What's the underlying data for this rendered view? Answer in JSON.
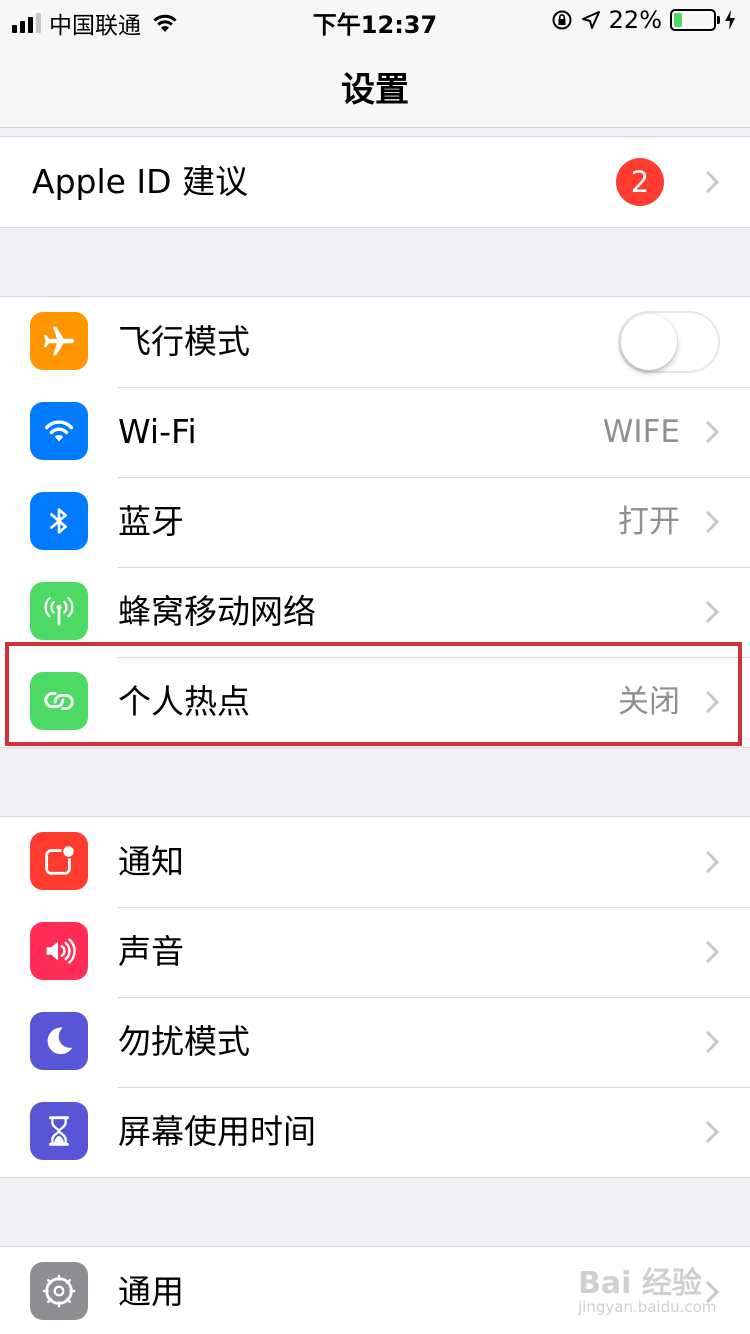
{
  "status_bar": {
    "carrier": "中国联通",
    "time": "下午12:37",
    "battery_percent_label": "22%",
    "battery_level": 0.22,
    "signal_bars": 3,
    "signal_total": 4
  },
  "nav": {
    "title": "设置"
  },
  "apple_id": {
    "label": "Apple ID 建议",
    "badge": "2"
  },
  "connectivity": [
    {
      "id": "airplane",
      "label": "飞行模式",
      "icon": "airplane-icon",
      "color": "#ff9500",
      "toggle": false
    },
    {
      "id": "wifi",
      "label": "Wi-Fi",
      "icon": "wifi-icon",
      "color": "#007aff",
      "value": "WIFE"
    },
    {
      "id": "bluetooth",
      "label": "蓝牙",
      "icon": "bluetooth-icon",
      "color": "#007aff",
      "value": "打开"
    },
    {
      "id": "cellular",
      "label": "蜂窝移动网络",
      "icon": "antenna-icon",
      "color": "#4cd964",
      "value": ""
    },
    {
      "id": "hotspot",
      "label": "个人热点",
      "icon": "hotspot-icon",
      "color": "#4cd964",
      "value": "关闭"
    }
  ],
  "notifications_group": [
    {
      "id": "notifications",
      "label": "通知",
      "icon": "notification-icon",
      "color": "#ff3b30"
    },
    {
      "id": "sounds",
      "label": "声音",
      "icon": "speaker-icon",
      "color": "#ff2d55"
    },
    {
      "id": "dnd",
      "label": "勿扰模式",
      "icon": "moon-icon",
      "color": "#5856d6"
    },
    {
      "id": "screentime",
      "label": "屏幕使用时间",
      "icon": "hourglass-icon",
      "color": "#5856d6"
    }
  ],
  "general_group": [
    {
      "id": "general",
      "label": "通用",
      "icon": "gear-icon",
      "color": "#8e8e93"
    }
  ],
  "watermark": {
    "text": "Bai 经验",
    "sub": "jingyan.baidu.com"
  }
}
